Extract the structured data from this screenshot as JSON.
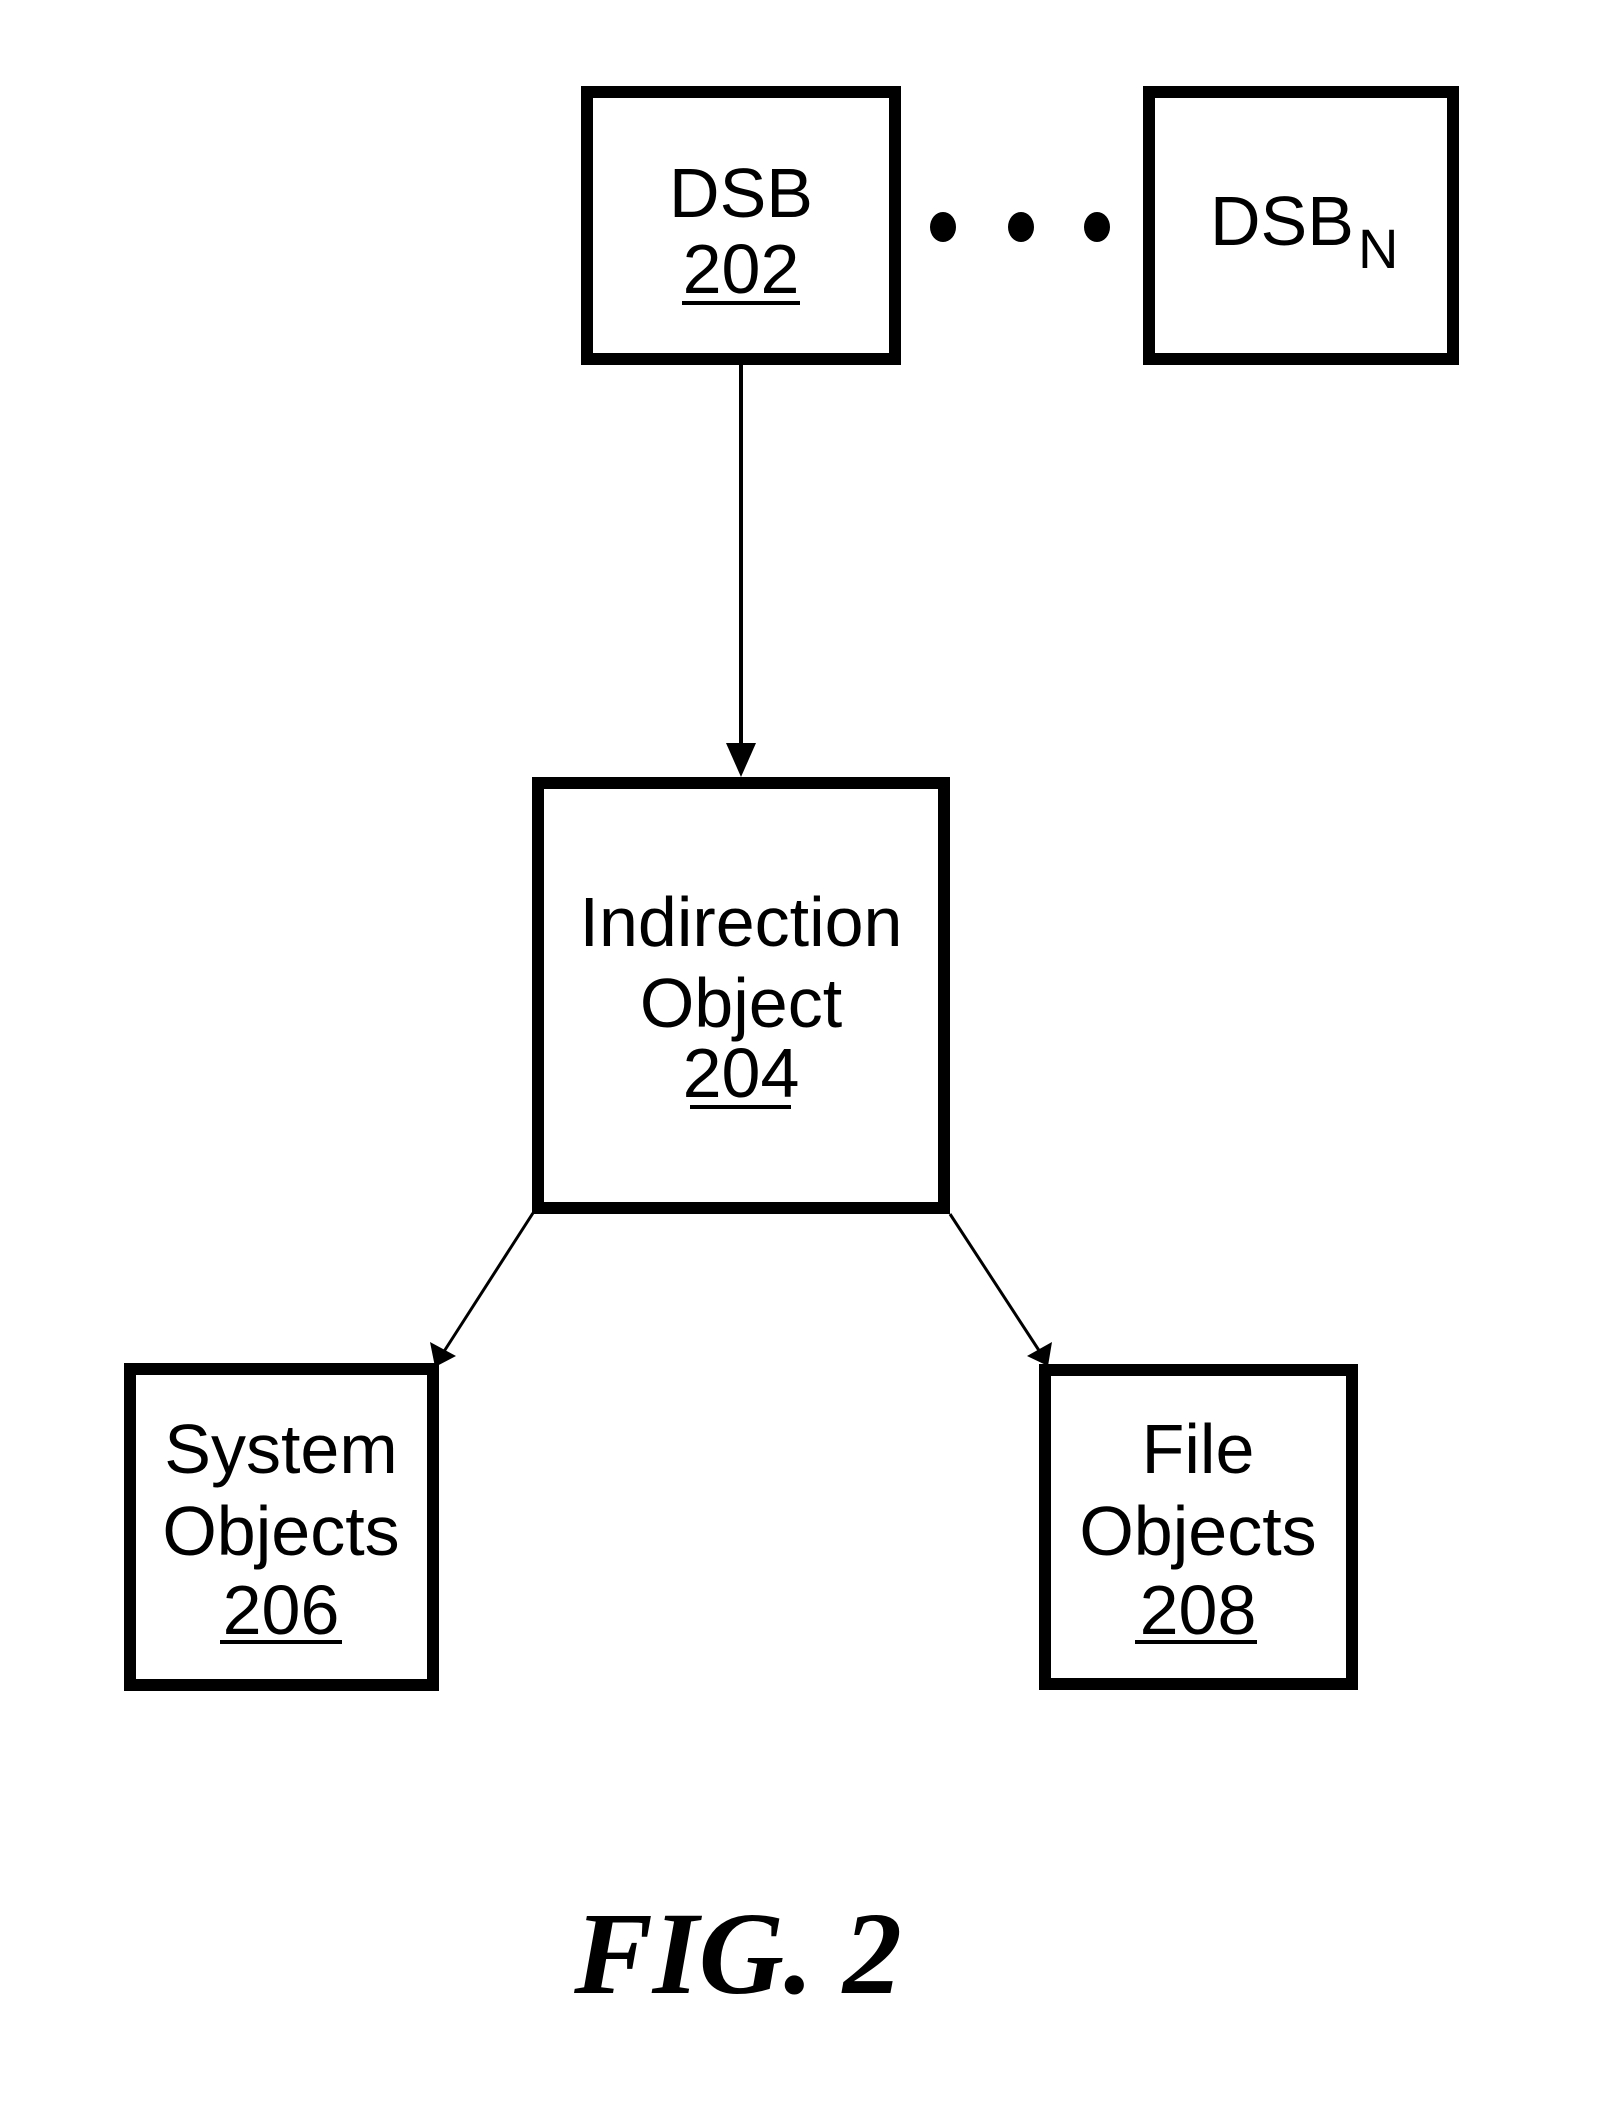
{
  "figure": {
    "caption": "FIG. 2",
    "nodes": {
      "dsb": {
        "line1": "DSB",
        "ref": "202"
      },
      "dsb_n": {
        "main": "DSB",
        "subscript": "N"
      },
      "indirection": {
        "line1": "Indirection",
        "line2": "Object",
        "ref": "204"
      },
      "system": {
        "line1": "System",
        "line2": "Objects",
        "ref": "206"
      },
      "file": {
        "line1": "File",
        "line2": "Objects",
        "ref": "208"
      }
    },
    "ellipsis_icon": "three-dots-horizontal",
    "edges": [
      {
        "from": "dsb",
        "to": "indirection"
      },
      {
        "from": "indirection",
        "to": "system"
      },
      {
        "from": "indirection",
        "to": "file"
      }
    ],
    "colors": {
      "stroke": "#000000",
      "background": "#ffffff"
    }
  }
}
